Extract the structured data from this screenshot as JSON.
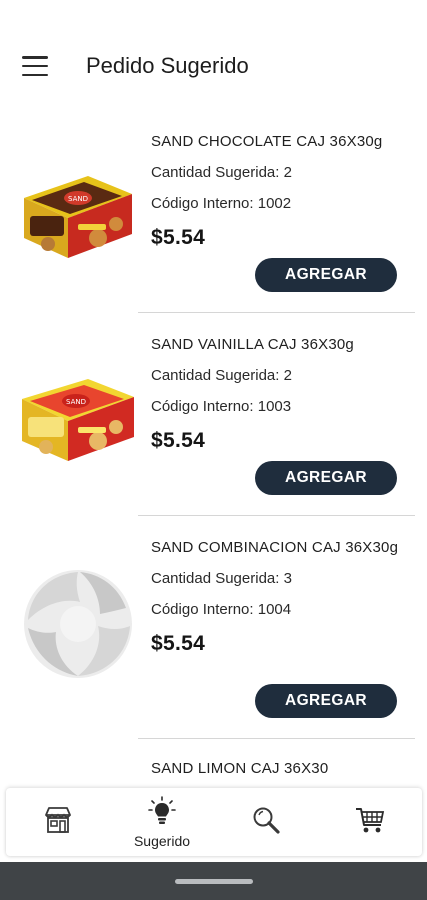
{
  "header": {
    "title": "Pedido Sugerido",
    "menu_icon": "hamburger-menu-icon"
  },
  "products": [
    {
      "name": "SAND CHOCOLATE CAJ 36X30g",
      "qty_label": "Cantidad Sugerida: 2",
      "code_label": "Código Interno: 1002",
      "price": "$5.54",
      "button": "AGREGAR",
      "image": "chocolate-cookie-box-image"
    },
    {
      "name": "SAND VAINILLA CAJ 36X30g",
      "qty_label": "Cantidad Sugerida: 2",
      "code_label": "Código Interno: 1003",
      "price": "$5.54",
      "button": "AGREGAR",
      "image": "vanilla-cookie-box-image"
    },
    {
      "name": "SAND COMBINACION CAJ 36X30g",
      "qty_label": "Cantidad Sugerida: 3",
      "code_label": "Código Interno: 1004",
      "price": "$5.54",
      "button": "AGREGAR",
      "image": "placeholder-logo-image"
    }
  ],
  "partial_item": {
    "name": "SAND LIMON CAJ 36X30"
  },
  "bottom_nav": {
    "items": [
      {
        "icon": "store-icon",
        "label": ""
      },
      {
        "icon": "lightbulb-icon",
        "label": "Sugerido"
      },
      {
        "icon": "search-icon",
        "label": ""
      },
      {
        "icon": "cart-icon",
        "label": ""
      }
    ]
  },
  "colors": {
    "button_bg": "#1f2d3d",
    "system_bar": "#404447"
  }
}
